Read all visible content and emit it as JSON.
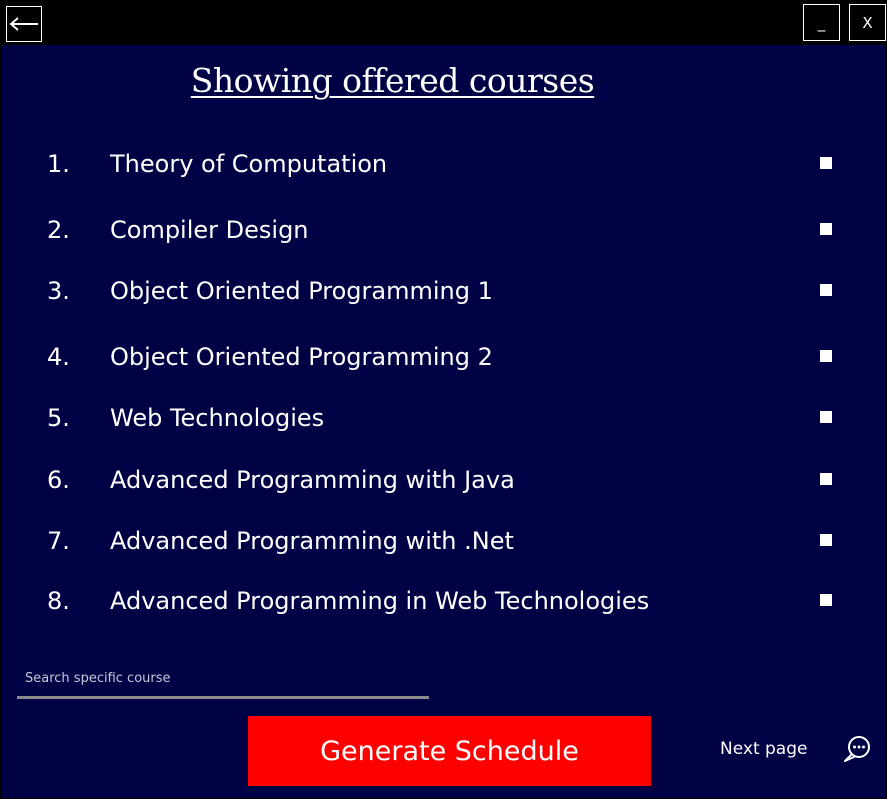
{
  "window": {
    "back_icon": "arrow-left-icon",
    "minimize_label": "_",
    "close_label": "X"
  },
  "page": {
    "title": "Showing offered courses"
  },
  "courses": [
    {
      "number": "1.",
      "name": "Theory of Computation"
    },
    {
      "number": "2.",
      "name": "Compiler Design"
    },
    {
      "number": "3.",
      "name": "Object Oriented Programming 1"
    },
    {
      "number": "4.",
      "name": "Object Oriented Programming 2"
    },
    {
      "number": "5.",
      "name": "Web Technologies"
    },
    {
      "number": "6.",
      "name": "Advanced Programming with Java"
    },
    {
      "number": "7.",
      "name": "Advanced Programming with .Net"
    },
    {
      "number": "8.",
      "name": "Advanced Programming in Web Technologies"
    }
  ],
  "search": {
    "placeholder": "Search specific course",
    "value": ""
  },
  "actions": {
    "generate_label": "Generate Schedule",
    "next_label": "Next page",
    "chat_icon": "chat-bubble-icon"
  },
  "colors": {
    "background": "#000044",
    "titlebar": "#000000",
    "generate_button": "#ff0000",
    "text": "#ffffff"
  }
}
